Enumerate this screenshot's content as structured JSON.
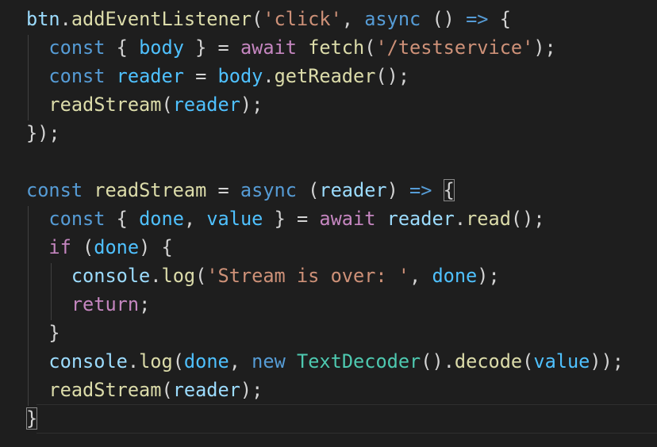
{
  "editor": {
    "lines": [
      [
        {
          "text": "btn",
          "cls": "t-var"
        },
        {
          "text": ".",
          "cls": "t-punc"
        },
        {
          "text": "addEventListener",
          "cls": "t-fn"
        },
        {
          "text": "(",
          "cls": "t-punc"
        },
        {
          "text": "'click'",
          "cls": "t-str"
        },
        {
          "text": ", ",
          "cls": "t-punc"
        },
        {
          "text": "async",
          "cls": "t-kw"
        },
        {
          "text": " () ",
          "cls": "t-punc"
        },
        {
          "text": "=>",
          "cls": "t-kw"
        },
        {
          "text": " {",
          "cls": "t-punc"
        }
      ],
      [
        {
          "text": "  ",
          "cls": "t-punc"
        },
        {
          "text": "const",
          "cls": "t-kw"
        },
        {
          "text": " { ",
          "cls": "t-punc"
        },
        {
          "text": "body",
          "cls": "t-const"
        },
        {
          "text": " } = ",
          "cls": "t-punc"
        },
        {
          "text": "await",
          "cls": "t-ctrl"
        },
        {
          "text": " ",
          "cls": "t-punc"
        },
        {
          "text": "fetch",
          "cls": "t-fn"
        },
        {
          "text": "(",
          "cls": "t-punc"
        },
        {
          "text": "'/testservice'",
          "cls": "t-str"
        },
        {
          "text": ");",
          "cls": "t-punc"
        }
      ],
      [
        {
          "text": "  ",
          "cls": "t-punc"
        },
        {
          "text": "const",
          "cls": "t-kw"
        },
        {
          "text": " ",
          "cls": "t-punc"
        },
        {
          "text": "reader",
          "cls": "t-const"
        },
        {
          "text": " = ",
          "cls": "t-punc"
        },
        {
          "text": "body",
          "cls": "t-const"
        },
        {
          "text": ".",
          "cls": "t-punc"
        },
        {
          "text": "getReader",
          "cls": "t-fn"
        },
        {
          "text": "();",
          "cls": "t-punc"
        }
      ],
      [
        {
          "text": "  ",
          "cls": "t-punc"
        },
        {
          "text": "readStream",
          "cls": "t-fn"
        },
        {
          "text": "(",
          "cls": "t-punc"
        },
        {
          "text": "reader",
          "cls": "t-const"
        },
        {
          "text": ");",
          "cls": "t-punc"
        }
      ],
      [
        {
          "text": "});",
          "cls": "t-punc"
        }
      ],
      [],
      [
        {
          "text": "const",
          "cls": "t-kw"
        },
        {
          "text": " ",
          "cls": "t-punc"
        },
        {
          "text": "readStream",
          "cls": "t-fn"
        },
        {
          "text": " = ",
          "cls": "t-punc"
        },
        {
          "text": "async",
          "cls": "t-kw"
        },
        {
          "text": " (",
          "cls": "t-punc"
        },
        {
          "text": "reader",
          "cls": "t-var"
        },
        {
          "text": ") ",
          "cls": "t-punc"
        },
        {
          "text": "=>",
          "cls": "t-kw"
        },
        {
          "text": " ",
          "cls": "t-punc"
        },
        {
          "text": "{",
          "cls": "t-punc",
          "hl": true
        }
      ],
      [
        {
          "text": "  ",
          "cls": "t-punc"
        },
        {
          "text": "const",
          "cls": "t-kw"
        },
        {
          "text": " { ",
          "cls": "t-punc"
        },
        {
          "text": "done",
          "cls": "t-const"
        },
        {
          "text": ", ",
          "cls": "t-punc"
        },
        {
          "text": "value",
          "cls": "t-const"
        },
        {
          "text": " } = ",
          "cls": "t-punc"
        },
        {
          "text": "await",
          "cls": "t-ctrl"
        },
        {
          "text": " ",
          "cls": "t-punc"
        },
        {
          "text": "reader",
          "cls": "t-var"
        },
        {
          "text": ".",
          "cls": "t-punc"
        },
        {
          "text": "read",
          "cls": "t-fn"
        },
        {
          "text": "();",
          "cls": "t-punc"
        }
      ],
      [
        {
          "text": "  ",
          "cls": "t-punc"
        },
        {
          "text": "if",
          "cls": "t-ctrl"
        },
        {
          "text": " (",
          "cls": "t-punc"
        },
        {
          "text": "done",
          "cls": "t-const"
        },
        {
          "text": ") {",
          "cls": "t-punc"
        }
      ],
      [
        {
          "text": "    ",
          "cls": "t-punc"
        },
        {
          "text": "console",
          "cls": "t-var"
        },
        {
          "text": ".",
          "cls": "t-punc"
        },
        {
          "text": "log",
          "cls": "t-fn"
        },
        {
          "text": "(",
          "cls": "t-punc"
        },
        {
          "text": "'Stream is over: '",
          "cls": "t-str"
        },
        {
          "text": ", ",
          "cls": "t-punc"
        },
        {
          "text": "done",
          "cls": "t-const"
        },
        {
          "text": ");",
          "cls": "t-punc"
        }
      ],
      [
        {
          "text": "    ",
          "cls": "t-punc"
        },
        {
          "text": "return",
          "cls": "t-ctrl"
        },
        {
          "text": ";",
          "cls": "t-punc"
        }
      ],
      [
        {
          "text": "  }",
          "cls": "t-punc"
        }
      ],
      [
        {
          "text": "  ",
          "cls": "t-punc"
        },
        {
          "text": "console",
          "cls": "t-var"
        },
        {
          "text": ".",
          "cls": "t-punc"
        },
        {
          "text": "log",
          "cls": "t-fn"
        },
        {
          "text": "(",
          "cls": "t-punc"
        },
        {
          "text": "done",
          "cls": "t-const"
        },
        {
          "text": ", ",
          "cls": "t-punc"
        },
        {
          "text": "new",
          "cls": "t-kw"
        },
        {
          "text": " ",
          "cls": "t-punc"
        },
        {
          "text": "TextDecoder",
          "cls": "t-cls"
        },
        {
          "text": "().",
          "cls": "t-punc"
        },
        {
          "text": "decode",
          "cls": "t-fn"
        },
        {
          "text": "(",
          "cls": "t-punc"
        },
        {
          "text": "value",
          "cls": "t-const"
        },
        {
          "text": "));",
          "cls": "t-punc"
        }
      ],
      [
        {
          "text": "  ",
          "cls": "t-punc"
        },
        {
          "text": "readStream",
          "cls": "t-fn"
        },
        {
          "text": "(",
          "cls": "t-punc"
        },
        {
          "text": "reader",
          "cls": "t-var"
        },
        {
          "text": ");",
          "cls": "t-punc"
        }
      ],
      [
        {
          "text": "}",
          "cls": "t-punc",
          "hl": true
        }
      ]
    ]
  },
  "colors": {
    "background": "#1e1e1e",
    "variable": "#9cdcfe",
    "function": "#dcdcaa",
    "keyword": "#569cd6",
    "control": "#c586c0",
    "string": "#ce9178",
    "class": "#4ec9b0",
    "punctuation": "#d4d4d4",
    "constant": "#4fc1ff"
  }
}
